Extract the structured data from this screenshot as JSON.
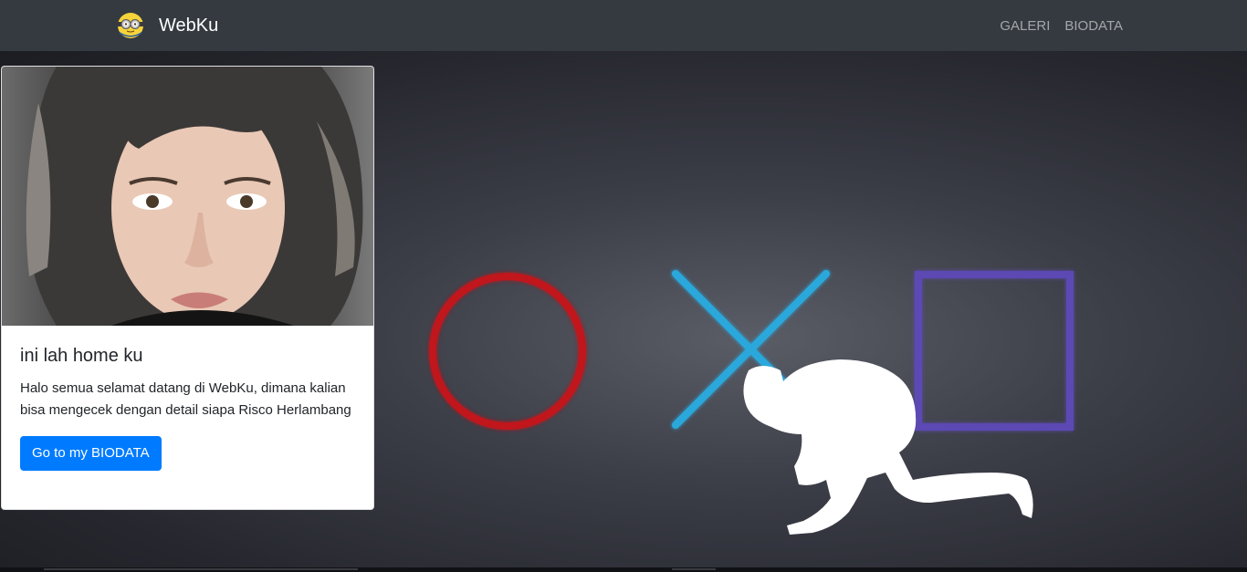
{
  "navbar": {
    "brand": "WebKu",
    "brand_icon": "minion-icon",
    "links": [
      "GALERI",
      "BIODATA"
    ],
    "background": "#343a40"
  },
  "card": {
    "image": "profile-photo",
    "title": "ini lah home ku",
    "text": "Halo semua selamat datang di WebKu, dimana kalian bisa mengecek dengan detail siapa Risco Herlambang",
    "button_label": "Go to my BIODATA",
    "button_color": "#007bff"
  },
  "hero": {
    "image": "playstation-symbols-background",
    "colors": {
      "circle": "#c0141c",
      "cross": "#2aa8dc",
      "square": "#5b4ab3"
    }
  }
}
